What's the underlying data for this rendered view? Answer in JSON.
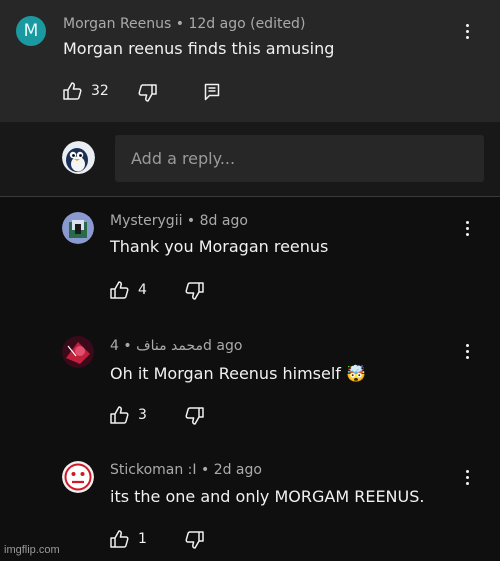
{
  "parent_comment": {
    "avatar_letter": "M",
    "author": "Morgan Reenus",
    "meta": " • 12d ago (edited)",
    "text": "Morgan reenus finds this amusing",
    "likes": "32",
    "like_icon": "thumbs-up-icon",
    "dislike_icon": "thumbs-down-icon",
    "reply_icon": "reply-icon"
  },
  "reply_box": {
    "placeholder": "Add a reply..."
  },
  "replies": [
    {
      "author": "Mysterygii",
      "meta": " • 8d ago",
      "text": "Thank you Moragan reenus",
      "likes": "4"
    },
    {
      "author": "محمد مناف",
      "meta": " • 4d ago",
      "text": "Oh it Morgan Reenus himself 🤯",
      "likes": "3"
    },
    {
      "author": "Stickoman :I",
      "meta": " • 2d ago",
      "text": "its the one and only MORGAM REENUS.",
      "likes": "1"
    }
  ],
  "watermark": "imgflip.com",
  "colors": {
    "background": "#0f0f0f",
    "parent_background": "#272727",
    "avatar_teal": "#1a9aa0",
    "meta_text": "#aaaaaa"
  }
}
